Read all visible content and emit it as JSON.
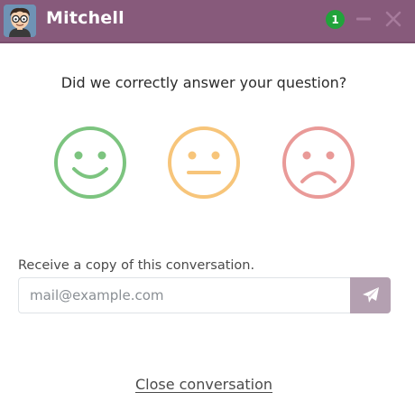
{
  "header": {
    "avatar_icon": "cartoon-avatar",
    "title": "Mitchell",
    "badge_count": "1",
    "minimize_icon": "minimize-icon",
    "close_icon": "close-icon",
    "background_color": "#875a7b"
  },
  "rating": {
    "question": "Did we correctly answer your question?",
    "options": [
      {
        "name": "happy",
        "color": "#7cc47f"
      },
      {
        "name": "neutral",
        "color": "#f7c57a"
      },
      {
        "name": "sad",
        "color": "#e99a98"
      }
    ]
  },
  "transcript": {
    "label": "Receive a copy of this conversation.",
    "email_placeholder": "mail@example.com",
    "send_icon": "paper-plane-icon"
  },
  "footer": {
    "close_label": "Close conversation"
  }
}
